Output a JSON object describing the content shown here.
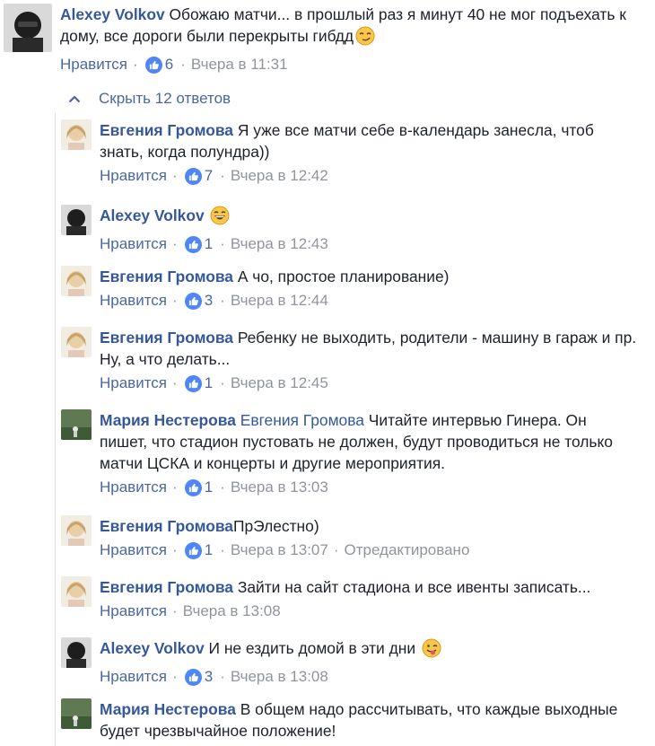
{
  "top_comment": {
    "author": "Alexey Volkov",
    "text": "Обожаю матчи... в прошлый раз я минут 40 не мог подъехать к дому, все дороги были перекрыты гибдд",
    "emoji": "smirk-emoji",
    "like_label": "Нравится",
    "likes": "6",
    "time": "Вчера в 11:31"
  },
  "replies_toggle": {
    "label": "Скрыть 12 ответов"
  },
  "replies": [
    {
      "author": "Евгения Громова",
      "text": "Я уже все матчи себе в-календарь занесла, чтоб знать, когда полундра))",
      "like_label": "Нравится",
      "likes": "7",
      "time": "Вчера в 12:42"
    },
    {
      "author": "Alexey Volkov",
      "text": "",
      "emoji": "grinning-sweat-emoji",
      "like_label": "Нравится",
      "likes": "1",
      "time": "Вчера в 12:43"
    },
    {
      "author": "Евгения Громова",
      "text": "А чо, простое планирование)",
      "like_label": "Нравится",
      "likes": "3",
      "time": "Вчера в 12:44"
    },
    {
      "author": "Евгения Громова",
      "text": "Ребенку не выходить, родители - машину в гараж и пр. Ну, а что делать...",
      "like_label": "Нравится",
      "likes": "1",
      "time": "Вчера в 12:45"
    },
    {
      "author": "Мария Нестерова",
      "mention": "Евгения Громова",
      "text": "Читайте интервью Гинера. Он пишет, что стадион пустовать не должен, будут проводиться не только матчи ЦСКА и концерты и другие мероприятия.",
      "like_label": "Нравится",
      "likes": "1",
      "time": "Вчера в 13:03"
    },
    {
      "author": "Евгения Громова",
      "text": "ПрЭлестно)",
      "like_label": "Нравится",
      "likes": "1",
      "time": "Вчера в 13:07",
      "edited": "Отредактировано"
    },
    {
      "author": "Евгения Громова",
      "text": "Зайти на сайт стадиона и все ивенты записать...",
      "like_label": "Нравится",
      "time": "Вчера в 13:08"
    },
    {
      "author": "Alexey Volkov",
      "text": "И не ездить домой в эти дни",
      "emoji": "tongue-wink-emoji",
      "like_label": "Нравится",
      "likes": "3",
      "time": "Вчера в 13:08"
    },
    {
      "author": "Мария Нестерова",
      "text": "В общем надо рассчитывать, что каждые выходные будет чрезвычайное положение!"
    }
  ],
  "colors": {
    "author": "#365899",
    "meta": "#90949c",
    "link": "#4b67a1",
    "like_badge": "#4f86f5",
    "thread_line": "#dcdee3"
  }
}
